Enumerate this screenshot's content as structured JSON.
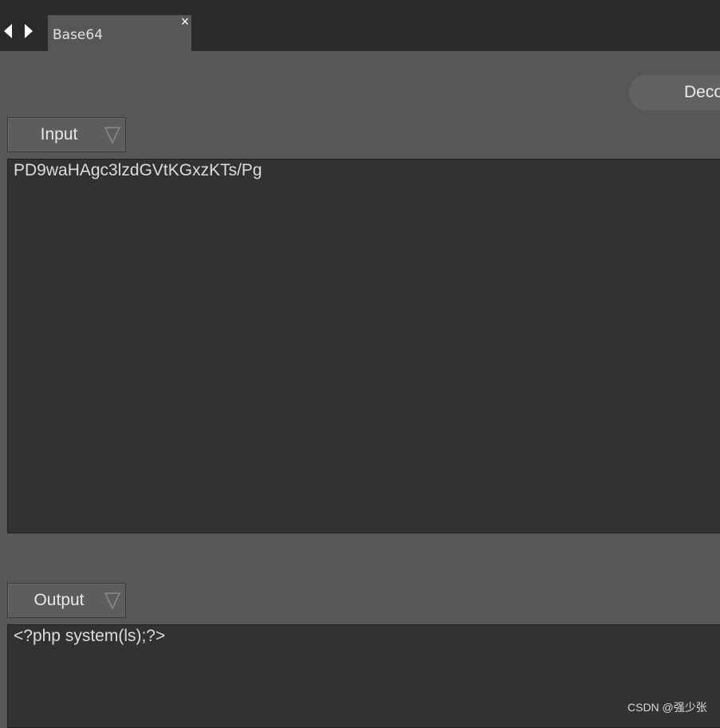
{
  "tab": {
    "label": "Base64",
    "close_label": "×"
  },
  "toolbar": {
    "decode_label": "Deco"
  },
  "input": {
    "selector_label": "Input",
    "value": "PD9waHAgc3lzdGVtKGxzKTs/Pg"
  },
  "output": {
    "selector_label": "Output",
    "value": "<?php system(ls);?>"
  },
  "watermark": "CSDN @强少张",
  "colors": {
    "background": "#575757",
    "topbar": "#2b2b2b",
    "textbox": "#323232",
    "text": "#dcdcdc"
  }
}
